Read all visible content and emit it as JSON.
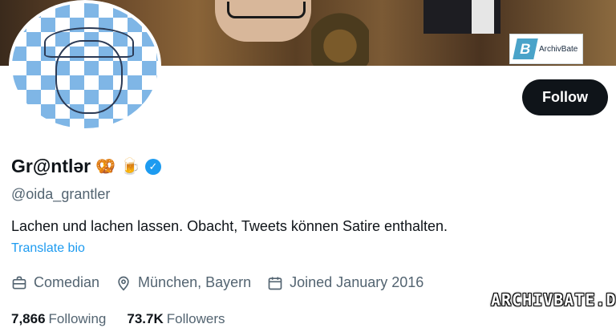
{
  "banner": {
    "logo_text": "ArchivBate"
  },
  "profile": {
    "display_name": "Gr@ntlər",
    "name_emojis": [
      "🥨",
      "🍺"
    ],
    "verified": true,
    "handle": "@oida_grantler",
    "bio": "Lachen und lachen lassen. Obacht, Tweets können Satire enthalten.",
    "translate_label": "Translate bio",
    "follow_label": "Follow",
    "profession": "Comedian",
    "location": "München, Bayern",
    "joined": "Joined January 2016",
    "following_count": "7,866",
    "following_label": "Following",
    "followers_count": "73.7K",
    "followers_label": "Followers"
  },
  "icons": {
    "profession": "briefcase-icon",
    "location": "location-pin-icon",
    "joined": "calendar-icon",
    "verified": "verified-badge-icon"
  },
  "colors": {
    "accent": "#1d9bf0",
    "follow_button_bg": "#0f1419",
    "secondary_text": "#536471"
  },
  "watermark": "ARCHIVBATE.DE"
}
